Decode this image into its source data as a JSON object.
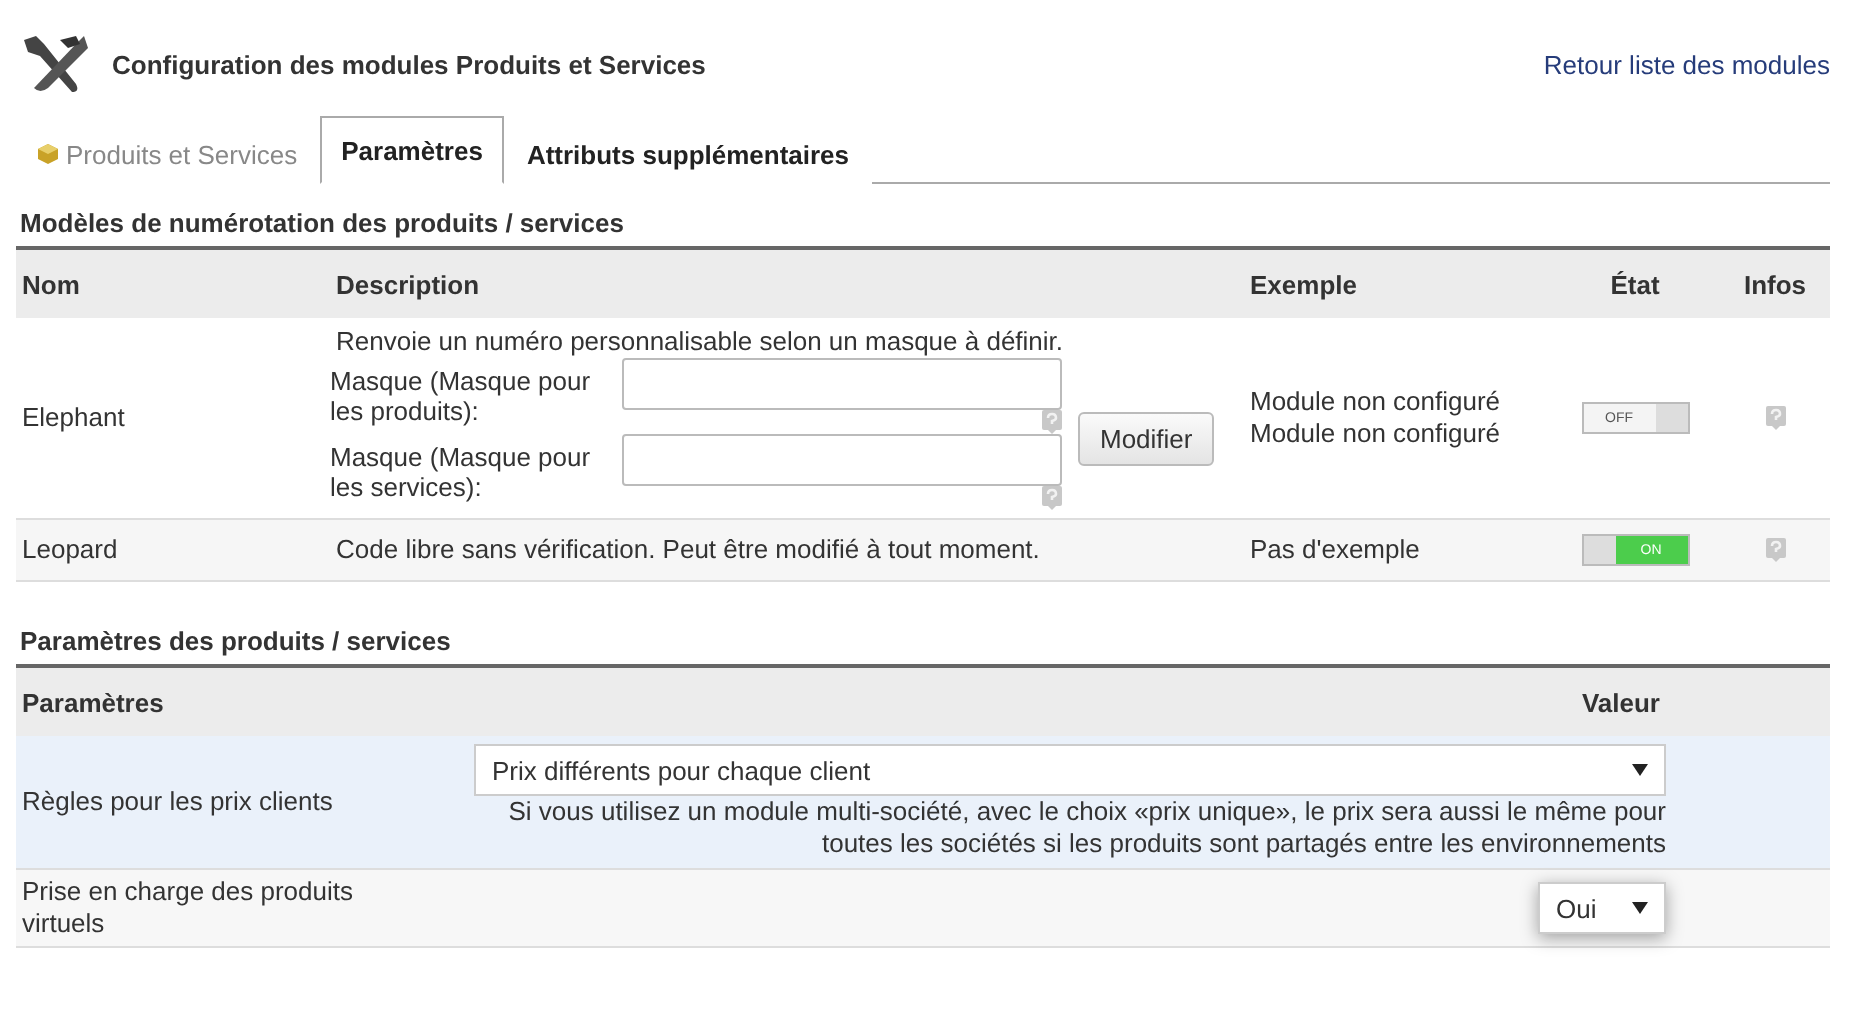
{
  "header": {
    "title": "Configuration des modules Produits et Services",
    "back_link": "Retour liste des modules"
  },
  "tabs": [
    {
      "label": "Produits et Services",
      "kind": "module",
      "selected": false
    },
    {
      "label": "Paramètres",
      "kind": "page",
      "selected": true
    },
    {
      "label": "Attributs supplémentaires",
      "kind": "page",
      "selected": false
    }
  ],
  "numbering": {
    "title": "Modèles de numérotation des produits / services",
    "columns": [
      "Nom",
      "Description",
      "Exemple",
      "État",
      "Infos"
    ],
    "rows": [
      {
        "name": "Elephant",
        "description": "Renvoie un numéro personnalisable selon un masque à définir.",
        "fields": [
          {
            "label": "Masque (Masque pour les produits):"
          },
          {
            "label": "Masque (Masque pour les services):"
          }
        ],
        "button": "Modifier",
        "example": [
          "Module non configuré",
          "Module non configuré"
        ],
        "on": false,
        "toggle_label": "OFF"
      },
      {
        "name": "Leopard",
        "description": "Code libre sans vérification. Peut être modifié à tout moment.",
        "example": [
          "Pas d'exemple"
        ],
        "on": true,
        "toggle_label": "ON"
      }
    ]
  },
  "params": {
    "title": "Paramètres des produits / services",
    "columns": [
      "Paramètres",
      "Valeur"
    ],
    "rows": [
      {
        "label": "Règles pour les prix clients",
        "kind": "wide",
        "highlighted": true,
        "value": "Prix différents pour chaque client",
        "note": "Si vous utilisez un module multi-société, avec le choix «prix unique», le prix sera aussi le même pour toutes les sociétés si les produits sont partagés entre les environnements"
      },
      {
        "label": "Prise en charge des produits virtuels",
        "kind": "compact",
        "highlighted": false,
        "value": "Oui"
      }
    ]
  }
}
